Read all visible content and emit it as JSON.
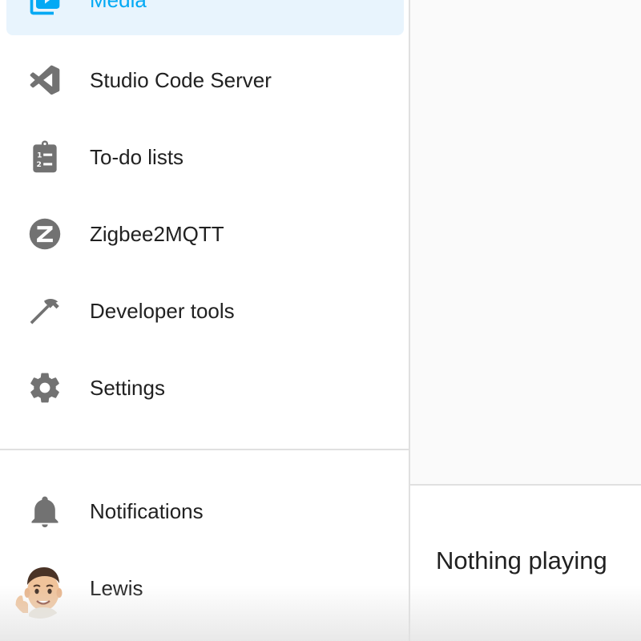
{
  "sidebar": {
    "items": [
      {
        "label": "Media",
        "icon": "media-icon",
        "selected": true
      },
      {
        "label": "Studio Code Server",
        "icon": "vscode-icon"
      },
      {
        "label": "To-do lists",
        "icon": "clipboard-list-icon"
      },
      {
        "label": "Zigbee2MQTT",
        "icon": "zigbee-icon"
      },
      {
        "label": "Developer tools",
        "icon": "hammer-icon"
      },
      {
        "label": "Settings",
        "icon": "gear-icon"
      }
    ],
    "notifications": {
      "label": "Notifications",
      "icon": "bell-icon"
    },
    "user": {
      "name": "Lewis",
      "icon": "avatar"
    }
  },
  "player": {
    "status": "Nothing playing"
  },
  "colors": {
    "accent": "#03a9f4",
    "selected_bg": "#e8f4fd",
    "icon": "#727272",
    "text": "#212121",
    "divider": "#e0e0e0"
  }
}
